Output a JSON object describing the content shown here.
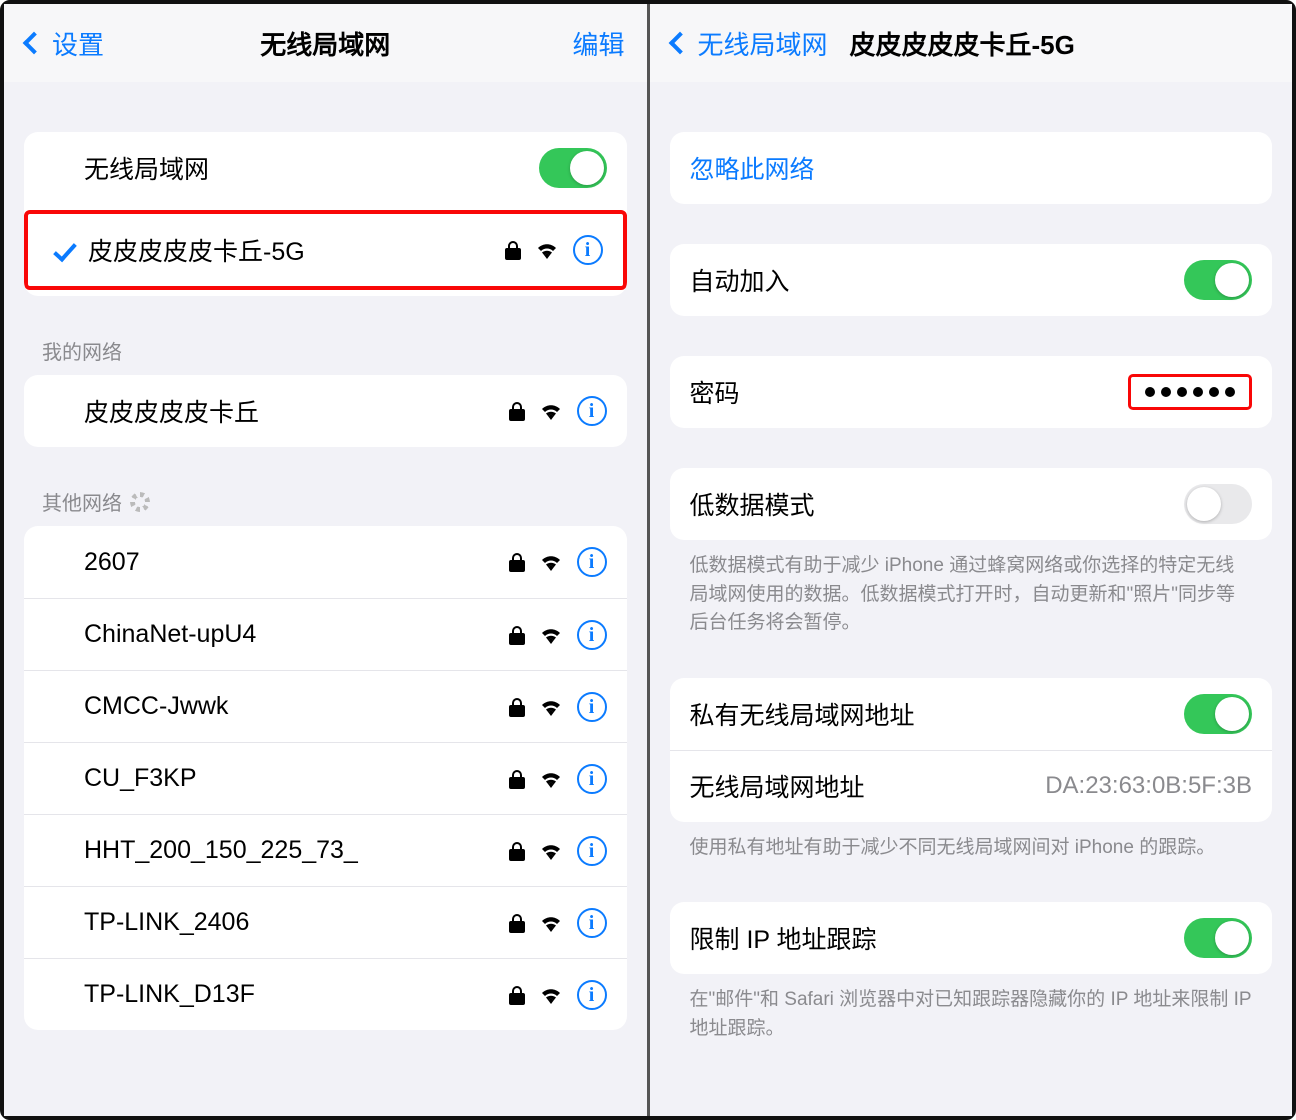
{
  "left": {
    "nav": {
      "back": "设置",
      "title": "无线局域网",
      "edit": "编辑"
    },
    "wifi_toggle_label": "无线局域网",
    "connected_network": "皮皮皮皮皮卡丘-5G",
    "my_networks_header": "我的网络",
    "my_networks": [
      {
        "name": "皮皮皮皮皮卡丘"
      }
    ],
    "other_networks_header": "其他网络",
    "other_networks": [
      {
        "name": "2607"
      },
      {
        "name": "ChinaNet-upU4"
      },
      {
        "name": "CMCC-Jwwk"
      },
      {
        "name": "CU_F3KP"
      },
      {
        "name": "HHT_200_150_225_73_"
      },
      {
        "name": "TP-LINK_2406"
      },
      {
        "name": "TP-LINK_D13F"
      }
    ]
  },
  "right": {
    "nav": {
      "back": "无线局域网",
      "title": "皮皮皮皮皮卡丘-5G"
    },
    "forget_label": "忽略此网络",
    "auto_join_label": "自动加入",
    "password_label": "密码",
    "low_data_label": "低数据模式",
    "low_data_footer": "低数据模式有助于减少 iPhone 通过蜂窝网络或你选择的特定无线局域网使用的数据。低数据模式打开时，自动更新和\"照片\"同步等后台任务将会暂停。",
    "private_addr_label": "私有无线局域网地址",
    "mac_label": "无线局域网地址",
    "mac_value": "DA:23:63:0B:5F:3B",
    "private_addr_footer": "使用私有地址有助于减少不同无线局域网间对 iPhone 的跟踪。",
    "limit_ip_label": "限制 IP 地址跟踪",
    "limit_ip_footer": "在\"邮件\"和 Safari 浏览器中对已知跟踪器隐藏你的 IP 地址来限制 IP 地址跟踪。"
  }
}
